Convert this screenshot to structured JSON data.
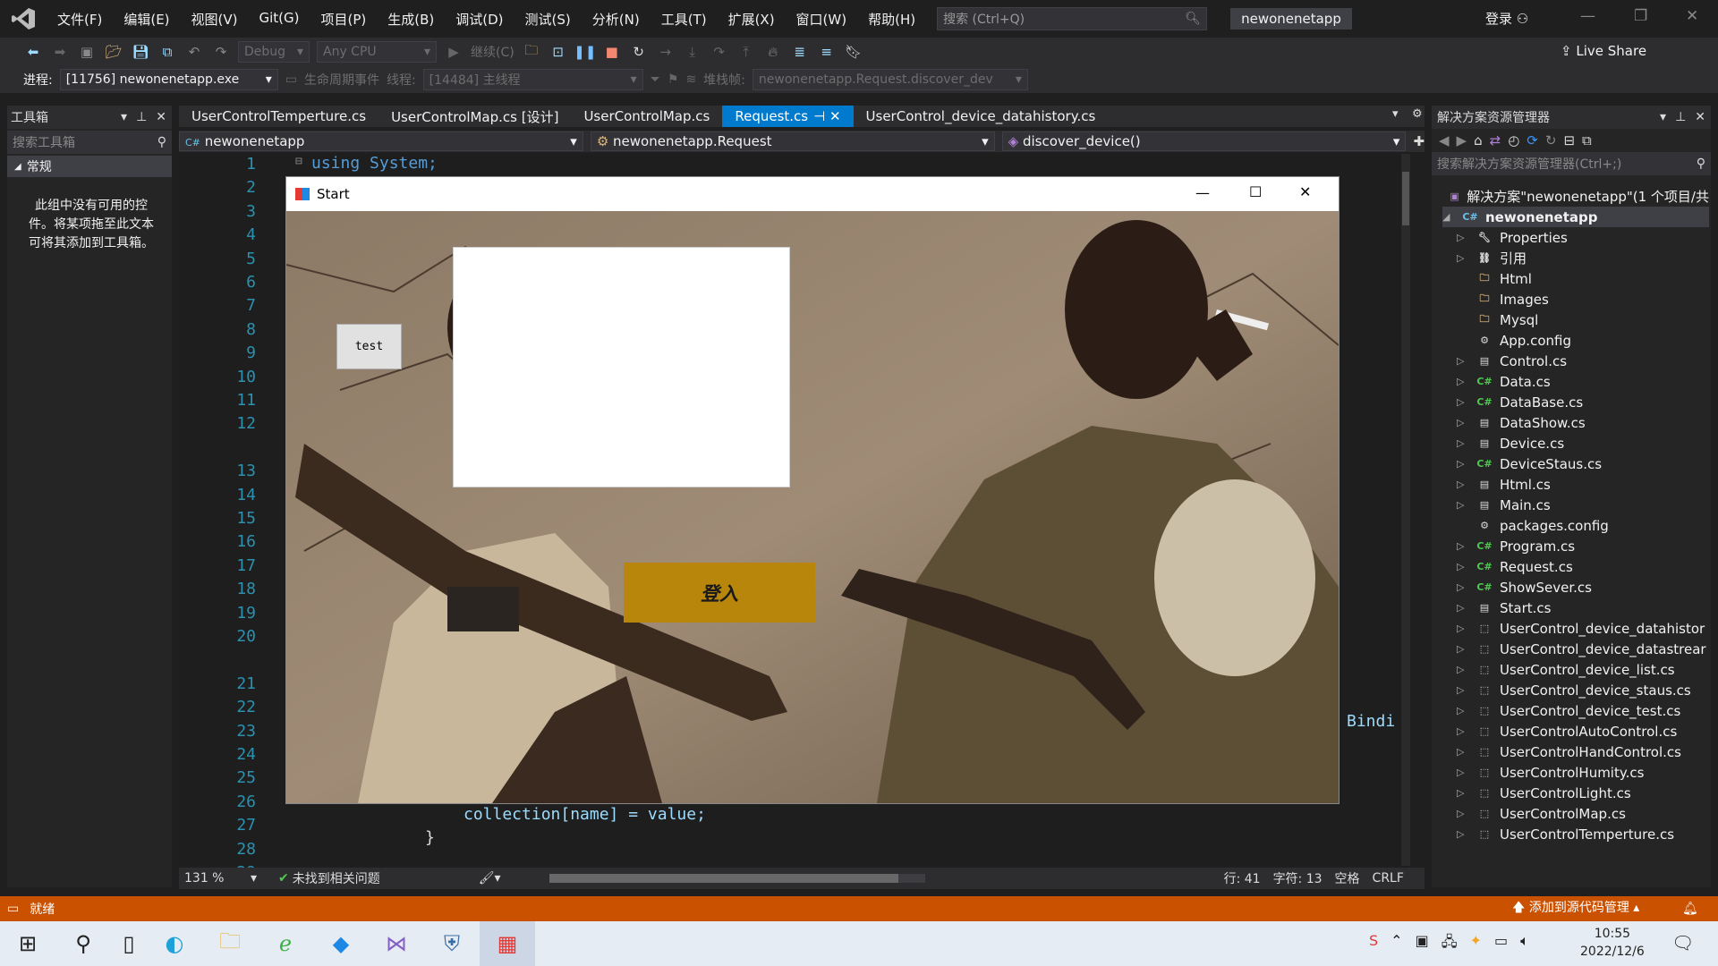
{
  "menu": [
    "文件(F)",
    "编辑(E)",
    "视图(V)",
    "Git(G)",
    "项目(P)",
    "生成(B)",
    "调试(D)",
    "测试(S)",
    "分析(N)",
    "工具(T)",
    "扩展(X)",
    "窗口(W)",
    "帮助(H)"
  ],
  "search_placeholder": "搜索 (Ctrl+Q)",
  "solution_badge": "newonenetapp",
  "login_label": "登录",
  "live_share": "Live Share",
  "toolbar": {
    "config": "Debug",
    "platform": "Any CPU",
    "continue": "继续(C)"
  },
  "debug_bar": {
    "process_label": "进程:",
    "process_value": "[11756] newonenetapp.exe",
    "lifecycle": "生命周期事件",
    "thread_label": "线程:",
    "thread_value": "[14484] 主线程",
    "stack_label": "堆栈帧:",
    "stack_value": "newonenetapp.Request.discover_dev"
  },
  "toolbox": {
    "title": "工具箱",
    "search": "搜索工具箱",
    "group": "常规",
    "empty_text": "此组中没有可用的控件。将某项拖至此文本可将其添加到工具箱。"
  },
  "tabs": [
    "UserControlTemperture.cs",
    "UserControlMap.cs [设计]",
    "UserControlMap.cs",
    "Request.cs",
    "UserControl_device_datahistory.cs"
  ],
  "active_tab": "Request.cs",
  "nav": {
    "project": "newonenetapp",
    "class": "newonenetapp.Request",
    "member": "discover_device()"
  },
  "code": {
    "line1": "using System;",
    "line27": "collection[name] = value;",
    "line28": "}",
    "partial_right": "Bindi"
  },
  "line_numbers": [
    "1",
    "2",
    "3",
    "4",
    "5",
    "6",
    "7",
    "8",
    "9",
    "10",
    "11",
    "12",
    "13",
    "14",
    "15",
    "16",
    "17",
    "18",
    "19",
    "20",
    "21",
    "22",
    "23",
    "24",
    "25",
    "26",
    "27",
    "28",
    "29"
  ],
  "status": {
    "zoom": "131 %",
    "issues": "未找到相关问题",
    "line": "行: 41",
    "char": "字符: 13",
    "space": "空格",
    "eol": "CRLF"
  },
  "solution_explorer": {
    "title": "解决方案资源管理器",
    "search": "搜索解决方案资源管理器(Ctrl+;)",
    "solution": "解决方案\"newonenetapp\"(1 个项目/共",
    "project": "newonenetapp",
    "items": [
      {
        "label": "Properties",
        "icon": "wrench-icon",
        "arrow": true
      },
      {
        "label": "引用",
        "icon": "references-icon",
        "arrow": true
      },
      {
        "label": "Html",
        "icon": "folder-icon",
        "arrow": false
      },
      {
        "label": "Images",
        "icon": "folder-icon",
        "arrow": false
      },
      {
        "label": "Mysql",
        "icon": "folder-icon",
        "arrow": false
      },
      {
        "label": "App.config",
        "icon": "config-icon",
        "arrow": false
      },
      {
        "label": "Control.cs",
        "icon": "form-icon",
        "arrow": true
      },
      {
        "label": "Data.cs",
        "icon": "csharp-icon",
        "arrow": true
      },
      {
        "label": "DataBase.cs",
        "icon": "csharp-icon",
        "arrow": true
      },
      {
        "label": "DataShow.cs",
        "icon": "form-icon",
        "arrow": true
      },
      {
        "label": "Device.cs",
        "icon": "form-icon",
        "arrow": true
      },
      {
        "label": "DeviceStaus.cs",
        "icon": "csharp-icon",
        "arrow": true
      },
      {
        "label": "Html.cs",
        "icon": "form-icon",
        "arrow": true
      },
      {
        "label": "Main.cs",
        "icon": "form-icon",
        "arrow": true
      },
      {
        "label": "packages.config",
        "icon": "config-icon",
        "arrow": false
      },
      {
        "label": "Program.cs",
        "icon": "csharp-icon",
        "arrow": true
      },
      {
        "label": "Request.cs",
        "icon": "csharp-icon",
        "arrow": true
      },
      {
        "label": "ShowSever.cs",
        "icon": "csharp-icon",
        "arrow": true
      },
      {
        "label": "Start.cs",
        "icon": "form-icon",
        "arrow": true
      },
      {
        "label": "UserControl_device_datahistor",
        "icon": "usercontrol-icon",
        "arrow": true
      },
      {
        "label": "UserControl_device_datastrear",
        "icon": "usercontrol-icon",
        "arrow": true
      },
      {
        "label": "UserControl_device_list.cs",
        "icon": "usercontrol-icon",
        "arrow": true
      },
      {
        "label": "UserControl_device_staus.cs",
        "icon": "usercontrol-icon",
        "arrow": true
      },
      {
        "label": "UserControl_device_test.cs",
        "icon": "usercontrol-icon",
        "arrow": true
      },
      {
        "label": "UserControlAutoControl.cs",
        "icon": "usercontrol-icon",
        "arrow": true
      },
      {
        "label": "UserControlHandControl.cs",
        "icon": "usercontrol-icon",
        "arrow": true
      },
      {
        "label": "UserControlHumity.cs",
        "icon": "usercontrol-icon",
        "arrow": true
      },
      {
        "label": "UserControlLight.cs",
        "icon": "usercontrol-icon",
        "arrow": true
      },
      {
        "label": "UserControlMap.cs",
        "icon": "usercontrol-icon",
        "arrow": true
      },
      {
        "label": "UserControlTemperture.cs",
        "icon": "usercontrol-icon",
        "arrow": true
      }
    ]
  },
  "bottom": {
    "ready": "就绪",
    "source_control": "添加到源代码管理"
  },
  "start_window": {
    "title": "Start",
    "test_button": "test",
    "login_button": "登入"
  },
  "clock": {
    "time": "10:55",
    "date": "2022/12/6"
  },
  "colors": {
    "accent": "#007acc",
    "status_orange": "#ca5100",
    "login_gold": "#b8860b"
  }
}
